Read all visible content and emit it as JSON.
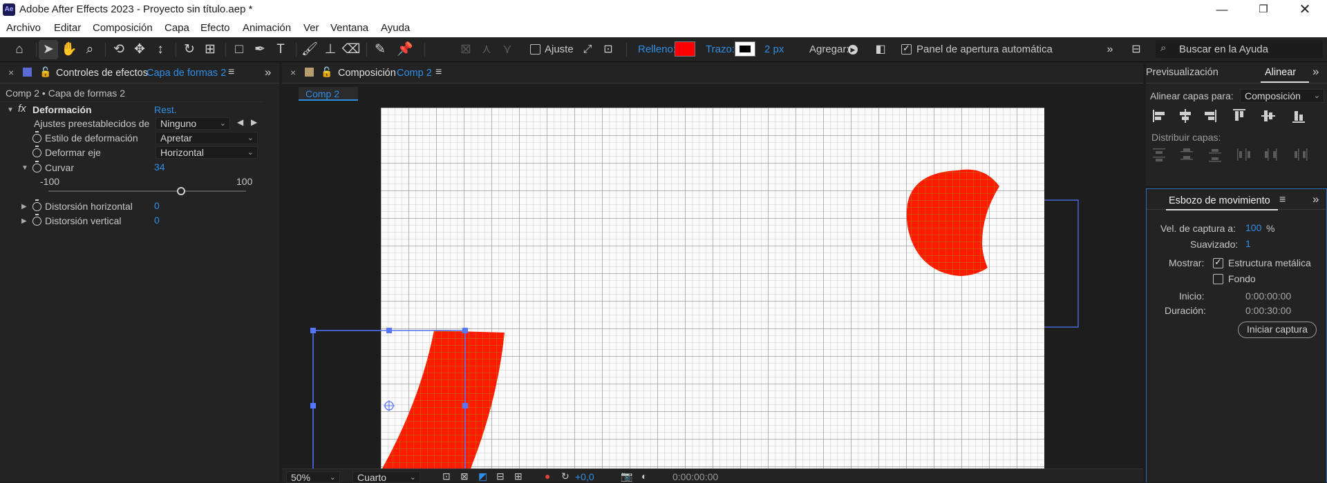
{
  "window": {
    "title": "Adobe After Effects 2023 - Proyecto sin título.aep *",
    "logo": "Ae"
  },
  "menu": [
    "Archivo",
    "Editar",
    "Composición",
    "Capa",
    "Efecto",
    "Animación",
    "Ver",
    "Ventana",
    "Ayuda"
  ],
  "toolbar": {
    "snap_label": "Ajuste",
    "fill_label": "Relleno:",
    "fill_color": "#ff0000",
    "stroke_label": "Trazo:",
    "stroke_width": "2 px",
    "add_label": "Agregar:",
    "auto_open_label": "Panel de apertura automática",
    "search_placeholder": "Buscar en la Ayuda"
  },
  "effects_panel": {
    "tab_label": "Controles de efectos",
    "tab_layer": "Capa de formas 2",
    "breadcrumb": "Comp 2 • Capa de formas 2",
    "effect_name": "Deformación",
    "reset_label": "Rest.",
    "presets_label": "Ajustes preestablecidos de",
    "presets_value": "Ninguno",
    "style_label": "Estilo de deformación",
    "style_value": "Apretar",
    "axis_label": "Deformar eje",
    "axis_value": "Horizontal",
    "bend_label": "Curvar",
    "bend_value": "34",
    "slider_min": "-100",
    "slider_max": "100",
    "slider_position": 0.67,
    "hdist_label": "Distorsión horizontal",
    "hdist_value": "0",
    "vdist_label": "Distorsión vertical",
    "vdist_value": "0"
  },
  "composition_panel": {
    "tab_label": "Composición",
    "tab_comp": "Comp 2",
    "comp_chip": "Comp 2",
    "zoom": "50%",
    "resolution": "Cuarto",
    "exposure": "+0,0",
    "timecode": "0:00:00:00"
  },
  "right_panel": {
    "preview_tab": "Previsualización",
    "align_tab": "Alinear",
    "align_to_label": "Alinear capas para:",
    "align_to_value": "Composición",
    "distribute_label": "Distribuir capas:"
  },
  "motion_sketch": {
    "tab_label": "Esbozo de movimiento",
    "capture_speed_label": "Vel. de captura a:",
    "capture_speed_value": "100",
    "capture_speed_unit": "%",
    "smoothing_label": "Suavizado:",
    "smoothing_value": "1",
    "show_label": "Mostrar:",
    "wireframe_label": "Estructura metálica",
    "wireframe_checked": true,
    "background_label": "Fondo",
    "background_checked": false,
    "start_label": "Inicio:",
    "start_value": "0:00:00:00",
    "duration_label": "Duración:",
    "duration_value": "0:00:30:00",
    "start_capture_button": "Iniciar captura"
  },
  "colors": {
    "accent": "#2f8fe6",
    "shape_fill": "#ff1a00",
    "selection": "#5577ff"
  }
}
